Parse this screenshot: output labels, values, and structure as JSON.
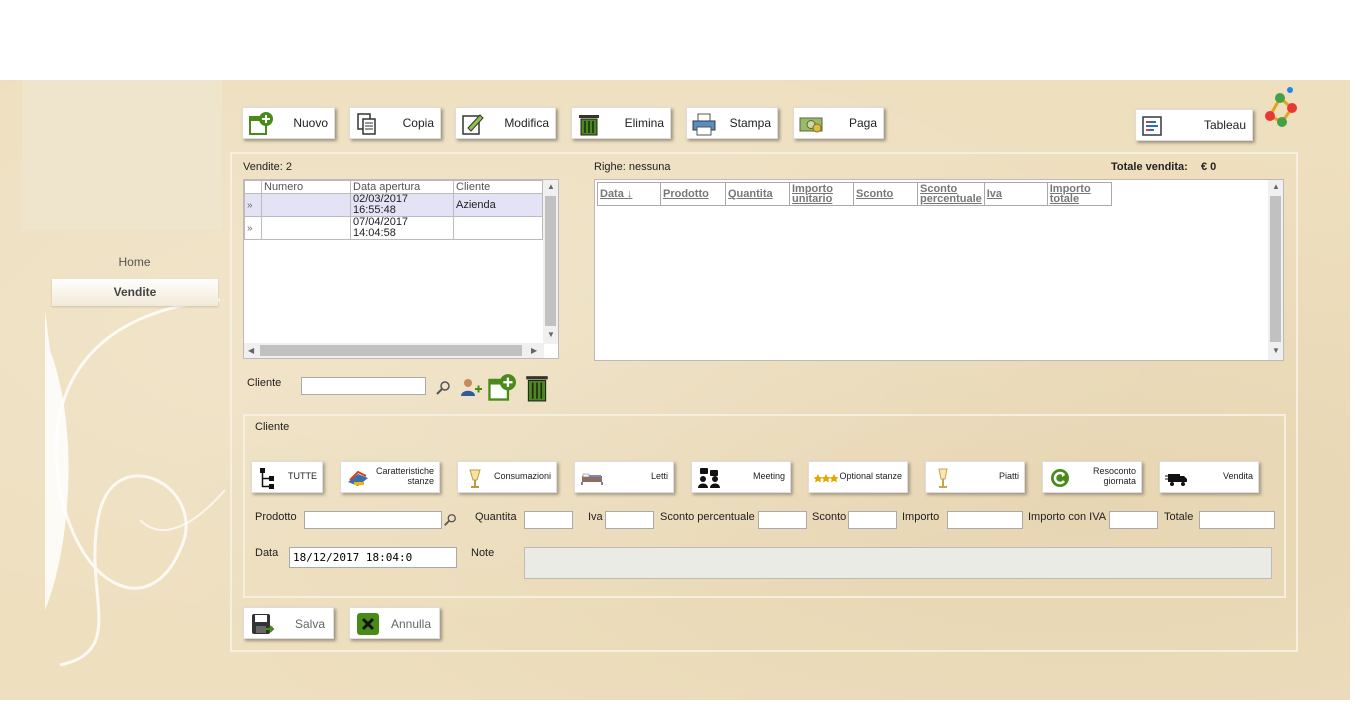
{
  "nav": {
    "home": "Home",
    "vendite": "Vendite"
  },
  "toolbar": [
    {
      "label": "Nuovo",
      "icon": "new-document-icon"
    },
    {
      "label": "Copia",
      "icon": "copy-icon"
    },
    {
      "label": "Modifica",
      "icon": "edit-icon"
    },
    {
      "label": "Elimina",
      "icon": "trash-icon"
    },
    {
      "label": "Stampa",
      "icon": "printer-icon"
    },
    {
      "label": "Paga",
      "icon": "money-icon"
    }
  ],
  "tableau": "Tableau",
  "sales": {
    "count_label": "Vendite: 2",
    "columns": [
      "Numero",
      "Data apertura",
      "Cliente"
    ],
    "rows": [
      {
        "numero": "",
        "data_line1": "02/03/2017",
        "data_line2": "16:55:48",
        "cliente": "Azienda"
      },
      {
        "numero": "",
        "data_line1": "07/04/2017",
        "data_line2": "14:04:58",
        "cliente": ""
      }
    ]
  },
  "lines": {
    "label": "Righe: nessuna",
    "total_label": "Totale vendita:",
    "total_value": "€ 0",
    "columns": [
      "Data ↓",
      "Prodotto",
      "Quantita",
      "Importo unitario",
      "Sconto",
      "Sconto percentuale",
      "Iva",
      "Importo totale"
    ]
  },
  "cliente_filter": {
    "label": "Cliente",
    "value": ""
  },
  "panel": {
    "title": "Cliente",
    "categories": [
      {
        "label": "TUTTE",
        "icon": "hierarchy-icon"
      },
      {
        "label": "Caratteristiche stanze",
        "icon": "room-features-icon"
      },
      {
        "label": "Consumazioni",
        "icon": "drink-icon"
      },
      {
        "label": "Letti",
        "icon": "bed-icon"
      },
      {
        "label": "Meeting",
        "icon": "meeting-icon"
      },
      {
        "label": "Optional stanze",
        "icon": "stars-icon"
      },
      {
        "label": "Piatti",
        "icon": "cocktail-icon"
      },
      {
        "label": "Resoconto giornata",
        "icon": "refresh-icon"
      },
      {
        "label": "Vendita",
        "icon": "truck-icon"
      }
    ],
    "fields": {
      "prodotto": "Prodotto",
      "quantita": "Quantita",
      "iva": "Iva",
      "sconto_percentuale": "Sconto percentuale",
      "sconto": "Sconto",
      "importo": "Importo",
      "importo_iva": "Importo con IVA",
      "totale": "Totale",
      "data": "Data",
      "data_value": "18/12/2017 18:04:0",
      "note": "Note"
    }
  },
  "actions": {
    "salva": "Salva",
    "annulla": "Annulla"
  },
  "colors": {
    "background": "#eedfbf",
    "accent_green": "#4a8a1a"
  }
}
